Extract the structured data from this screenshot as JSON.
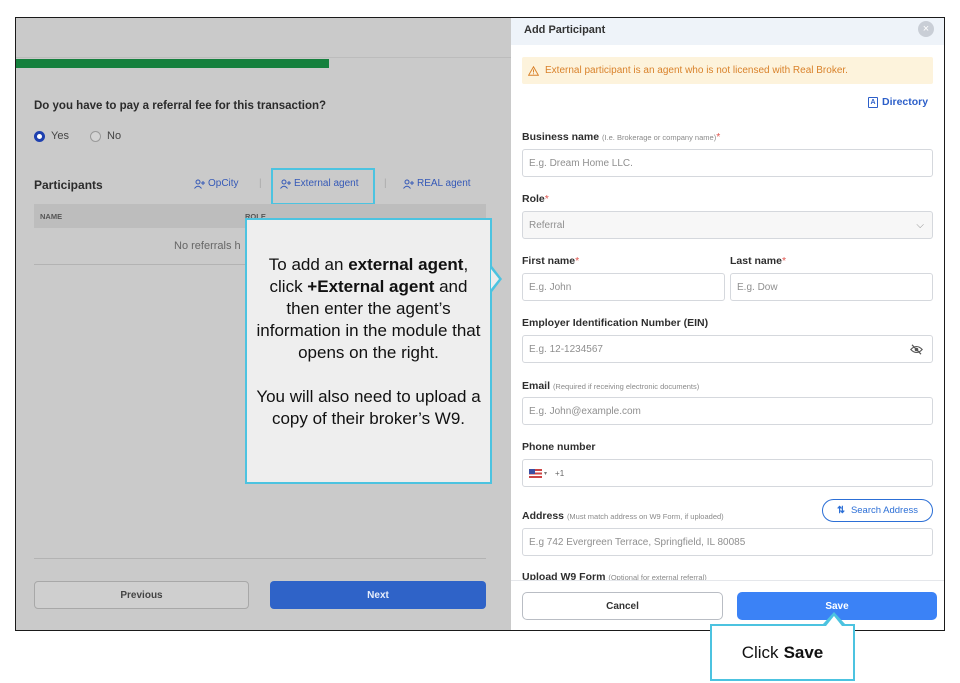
{
  "left_form": {
    "question": "Do you have to pay a referral fee for this transaction?",
    "radio_yes": "Yes",
    "radio_no": "No",
    "radio_selected": "Yes",
    "participants_title": "Participants",
    "add_opcity": "OpCity",
    "add_external_agent": "External agent",
    "add_real_agent": "REAL agent",
    "table_headers": [
      "NAME",
      "ROLE"
    ],
    "empty_text": "No referrals h",
    "previous_label": "Previous",
    "next_label": "Next",
    "progress_color": "#15803d"
  },
  "callout_left": {
    "p1_a": "To add an ",
    "p1_b": "external  agent",
    "p1_c": ", click ",
    "p1_d": "+External agent",
    "p1_e": " and then enter the agent’s information in the module that opens on the right.",
    "p2": "You will also need to upload a copy of their broker’s W9."
  },
  "panel": {
    "title": "Add Participant",
    "warning": "External participant is an agent who is not licensed with Real Broker.",
    "directory_label": "Directory",
    "business_name_label": "Business name",
    "business_name_hint": "(I.e. Brokerage or company name)",
    "business_name_placeholder": "E.g. Dream Home LLC.",
    "role_label": "Role",
    "role_value": "Referral",
    "first_name_label": "First name",
    "first_name_placeholder": "E.g. John",
    "last_name_label": "Last name",
    "last_name_placeholder": "E.g. Dow",
    "ein_label": "Employer Identification Number (EIN)",
    "ein_placeholder": "E.g. 12-1234567",
    "email_label": "Email",
    "email_hint": "(Required if receiving electronic documents)",
    "email_placeholder": "E.g. John@example.com",
    "phone_label": "Phone number",
    "phone_code": "+1",
    "address_label": "Address",
    "address_hint": "(Must match address on W9 Form, if uploaded)",
    "search_address_label": "Search Address",
    "address_placeholder": "E.g 742 Evergreen Terrace, Springfield, IL 80085",
    "upload_label": "Upload W9 Form",
    "upload_hint": "(Optional for external referral)",
    "cancel_label": "Cancel",
    "save_label": "Save",
    "accent_color": "#3b82f6",
    "warning_color": "#d9822b"
  },
  "callout_save": {
    "prefix": "Click",
    "bold": "Save"
  }
}
